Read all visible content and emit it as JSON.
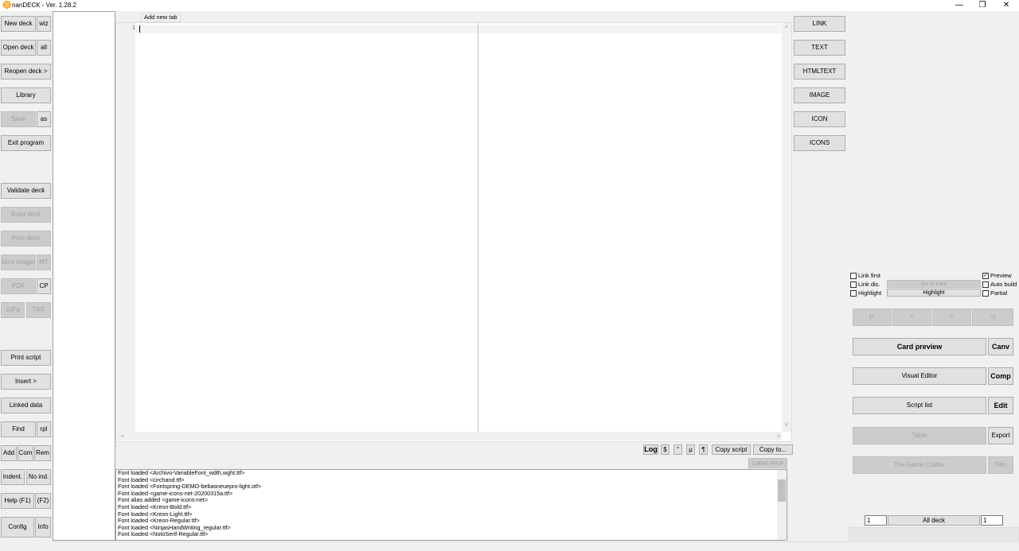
{
  "window": {
    "title": "nanDECK - Ver. 1.28.2",
    "app_icon": "nandeck-icon",
    "minimize": "—",
    "restore": "❐",
    "close": "✕"
  },
  "left_toolbar": {
    "new_deck": "New deck",
    "wiz": "wiz",
    "open_deck": "Open deck",
    "all": "all",
    "reopen_deck": "Reopen deck >",
    "library": "Library",
    "save": "Save",
    "as": "as",
    "exit_program": "Exit program",
    "validate_deck": "Validate deck",
    "build_deck": "Build deck",
    "print_deck": "Print deck",
    "save_images": "Save images",
    "mt": "MT",
    "pdf": "PDF",
    "cp": "CP",
    "gifa": "GIFa",
    "tiff": "TIFF",
    "print_script": "Print script",
    "insert": "Insert >",
    "linked_data": "Linked data",
    "find": "Find",
    "rpl": "rpl",
    "add": "Add",
    "com": "Com",
    "rem": "Rem",
    "indent": "Indent.",
    "no_ind": "No ind.",
    "help": "Help (F1)",
    "f2": "(F2)",
    "config": "Config",
    "info": "Info"
  },
  "editor": {
    "add_new_tab": "Add new tab",
    "line_number": "1",
    "hscroll_left": "<",
    "hscroll_right": ">",
    "vscroll_up": "^",
    "vscroll_down": "v"
  },
  "editor_toolbar": {
    "log": "Log",
    "dollar": "$",
    "quote": "\"",
    "mu": "µ",
    "pilcrow": "¶",
    "copy_script": "Copy script",
    "copy_to": "Copy to...",
    "label_error": "Label error"
  },
  "log": {
    "lines": [
      "Font loaded <Archivo-VariableFont_wdth,wght.ttf>",
      "Font loaded <circhand.ttf>",
      "Font loaded <Fontspring-DEMO-bebasneuepro-light.otf>",
      "Font loaded <game-icons-net-20200315a.ttf>",
      "Font alias added <game-icons-net>",
      "Font loaded <Kreon-Bold.ttf>",
      "Font loaded <Kreon-Light.ttf>",
      "Font loaded <Kreon-Regular.ttf>",
      "Font loaded <NinjasHandWriting_regular.ttf>",
      "Font loaded <NotoSerif-Regular.ttf>"
    ]
  },
  "directives": [
    "LINK",
    "TEXT",
    "HTMLTEXT",
    "IMAGE",
    "ICON",
    "ICONS"
  ],
  "preview_panel": {
    "link_first": "Link first",
    "link_dis": "Link dis.",
    "highlight_chk": "Highlight",
    "goto_card": "Go to card",
    "highlight_btn": "Highlight",
    "preview": "Preview",
    "auto_build": "Auto build",
    "partial": "Partial",
    "nav_first": "|<",
    "nav_prev": "<",
    "nav_next": ">",
    "nav_last": ">|",
    "card_preview": "Card preview",
    "canv": "Canv",
    "visual_editor": "Visual Editor",
    "comp": "Comp",
    "script_list": "Script list",
    "edit": "Edit",
    "table": "Table",
    "export": "Export",
    "game_crafter": "The Game Crafter",
    "sim": "Sim",
    "from_value": "1",
    "all_deck": "All deck",
    "to_value": "1"
  }
}
